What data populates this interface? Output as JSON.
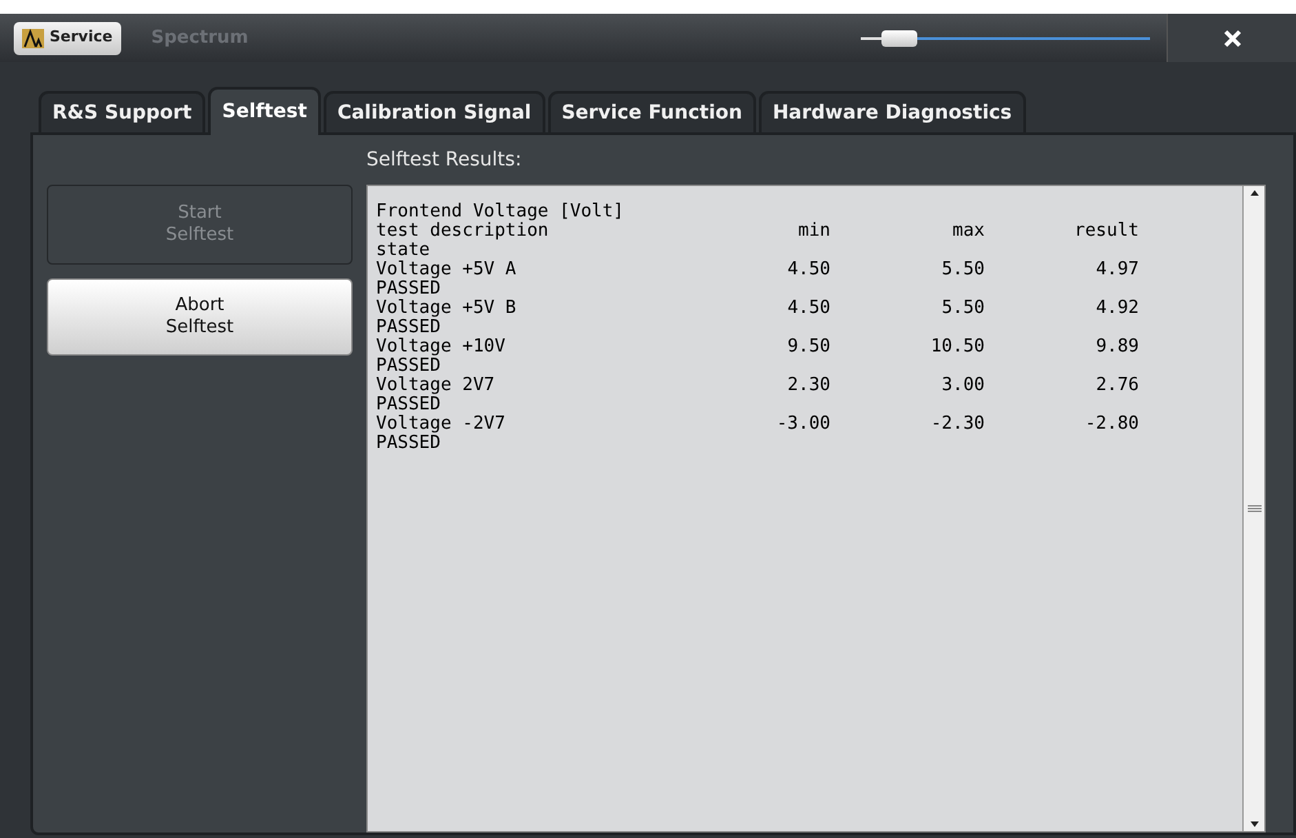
{
  "window": {
    "tabs": [
      {
        "label": "Service",
        "selected": true
      },
      {
        "label": "Spectrum",
        "selected": false
      }
    ],
    "slider": {
      "level": 0.1
    }
  },
  "dialog": {
    "tabs": [
      {
        "label": "R&S Support",
        "selected": false
      },
      {
        "label": "Selftest",
        "selected": true
      },
      {
        "label": "Calibration Signal",
        "selected": false
      },
      {
        "label": "Service Function",
        "selected": false
      },
      {
        "label": "Hardware Diagnostics",
        "selected": false
      }
    ],
    "buttons": [
      {
        "label": "Start\nSelftest",
        "disabled": true
      },
      {
        "label": "Abort\nSelftest",
        "disabled": false
      }
    ],
    "results_label": "Selftest Results:",
    "report": {
      "title": "Frontend Voltage [Volt]",
      "header": {
        "description": "test description",
        "min": "min",
        "max": "max",
        "result": "result",
        "state": "state"
      },
      "rows": [
        {
          "description": "Voltage +5V A",
          "min": "4.50",
          "max": "5.50",
          "result": "4.97",
          "state": "PASSED"
        },
        {
          "description": "Voltage +5V B",
          "min": "4.50",
          "max": "5.50",
          "result": "4.92",
          "state": "PASSED"
        },
        {
          "description": "Voltage +10V",
          "min": "9.50",
          "max": "10.50",
          "result": "9.89",
          "state": "PASSED"
        },
        {
          "description": "Voltage 2V7",
          "min": "2.30",
          "max": "3.00",
          "result": "2.76",
          "state": "PASSED"
        },
        {
          "description": "Voltage -2V7",
          "min": "-3.00",
          "max": "-2.30",
          "result": "-2.80",
          "state": "PASSED"
        }
      ]
    }
  }
}
